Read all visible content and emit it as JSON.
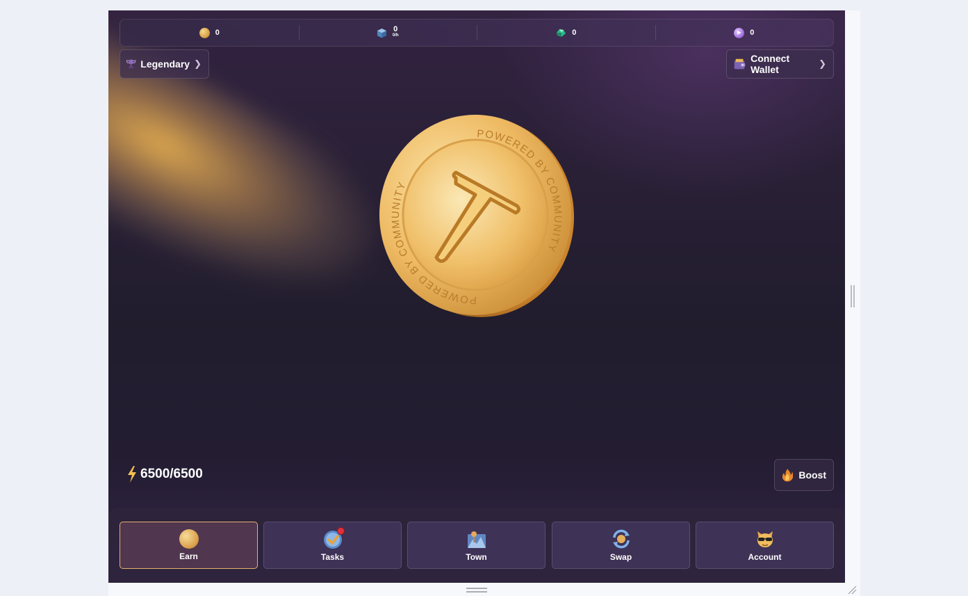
{
  "stats": [
    {
      "icon": "gold-coin-icon",
      "value": "0"
    },
    {
      "icon": "cube-icon",
      "value": "0",
      "sub": "0/h"
    },
    {
      "icon": "gem-icon",
      "value": "0"
    },
    {
      "icon": "purple-token-icon",
      "value": "0"
    }
  ],
  "league": {
    "label": "Legendary",
    "icon": "trophy-icon"
  },
  "wallet": {
    "label": "Connect Wallet",
    "icon": "wallet-icon"
  },
  "coin": {
    "inscription": "POWERED BY COMMUNITY"
  },
  "energy": {
    "value": "6500/6500",
    "icon": "lightning-icon"
  },
  "boost": {
    "label": "Boost",
    "icon": "flame-icon"
  },
  "nav": [
    {
      "label": "Earn",
      "icon": "coin-icon",
      "active": true
    },
    {
      "label": "Tasks",
      "icon": "tasks-check-icon",
      "badge": true
    },
    {
      "label": "Town",
      "icon": "town-icon"
    },
    {
      "label": "Swap",
      "icon": "swap-icon"
    },
    {
      "label": "Account",
      "icon": "cat-avatar-icon"
    }
  ],
  "colors": {
    "accent_gold": "#e6b26b",
    "badge_red": "#e0313a",
    "background": "#211d2d"
  }
}
